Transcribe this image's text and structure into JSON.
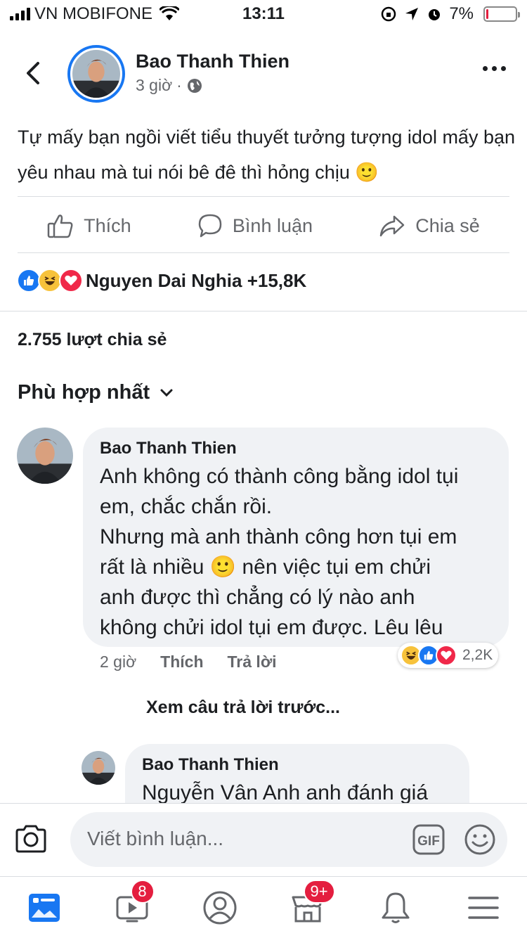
{
  "status_bar": {
    "carrier": "VN MOBIFONE",
    "time": "13:11",
    "battery_percent": "7%",
    "battery_level": 0.07
  },
  "post": {
    "author": "Bao Thanh Thien",
    "time_ago": "3 giờ",
    "separator": "·",
    "privacy_icon": "globe-icon",
    "text": "Tự mấy bạn ngồi viết tiểu thuyết tưởng tượng idol mấy bạn yêu nhau mà tui nói bê đê thì hỏng chịu",
    "emoji": "🙂"
  },
  "actions": {
    "like": "Thích",
    "comment": "Bình luận",
    "share": "Chia sẻ"
  },
  "reactions": {
    "icons": [
      "like-reaction-icon",
      "haha-reaction-icon",
      "love-reaction-icon"
    ],
    "summary": "Nguyen Dai Nghia +15,8K"
  },
  "shares": "2.755 lượt chia sẻ",
  "sort_label": "Phù hợp nhất",
  "comments": [
    {
      "author": "Bao Thanh Thien",
      "lines": [
        "Anh không có thành công bằng idol tụi",
        "em, chắc chắn rồi.",
        "Nhưng mà anh thành công hơn tụi em",
        "rất là nhiều",
        "nên việc tụi em chửi",
        "anh được thì chẳng có lý nào anh",
        "không chửi idol tụi em được. Lêu lêu"
      ],
      "emoji": "🙂",
      "time_ago": "2 giờ",
      "like_label": "Thích",
      "reply_label": "Trả lời",
      "reaction_count": "2,2K"
    },
    {
      "author": "Bao Thanh Thien",
      "text": "Nguyễn Vân Anh  anh đánh giá"
    }
  ],
  "view_previous": "Xem câu trả lời trước...",
  "comment_input": {
    "placeholder": "Viết bình luận...",
    "gif_label": "GIF"
  },
  "bottom_nav": {
    "video_badge": "8",
    "marketplace_badge": "9+"
  },
  "colors": {
    "accent": "#1877f2",
    "badge": "#e41e3f",
    "bubble": "#f0f2f5",
    "secondary_text": "#65676b"
  }
}
